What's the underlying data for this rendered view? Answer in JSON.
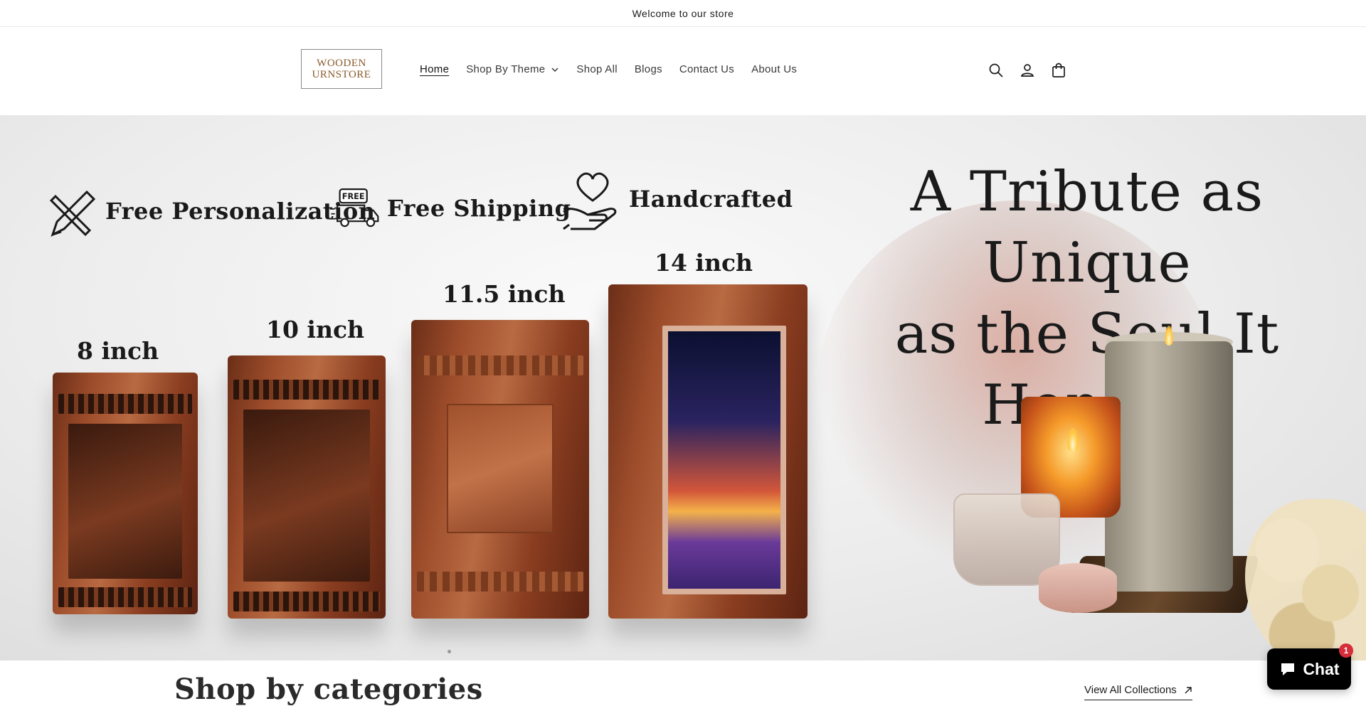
{
  "announcement": {
    "text": "Welcome to our store"
  },
  "header": {
    "logo": {
      "line1": "WOODEN",
      "line2": "URNSTORE"
    },
    "nav": [
      {
        "label": "Home",
        "active": true
      },
      {
        "label": "Shop By Theme",
        "dropdown": true
      },
      {
        "label": "Shop All"
      },
      {
        "label": "Blogs"
      },
      {
        "label": "Contact Us"
      },
      {
        "label": "About Us"
      }
    ],
    "icons": [
      "search-icon",
      "account-icon",
      "cart-icon"
    ]
  },
  "hero": {
    "features": [
      {
        "label": "Free Personalization",
        "icon": "pencil-icon"
      },
      {
        "label": "Free Shipping",
        "icon": "delivery-truck-icon",
        "icon_text": "FREE"
      },
      {
        "label": "Handcrafted",
        "icon": "heart-hand-icon"
      }
    ],
    "headline_line1": "A Tribute as Unique",
    "headline_line2": "as the Soul It Honors",
    "sizes": [
      "8 inch",
      "10 inch",
      "11.5 inch",
      "14 inch"
    ]
  },
  "categories": {
    "title": "Shop by categories",
    "view_all": "View All Collections"
  },
  "chat": {
    "label": "Chat",
    "badge": "1"
  },
  "colors": {
    "chat_bg": "#000000",
    "badge": "#d72c3a",
    "logo_text": "#8a5a2b"
  }
}
